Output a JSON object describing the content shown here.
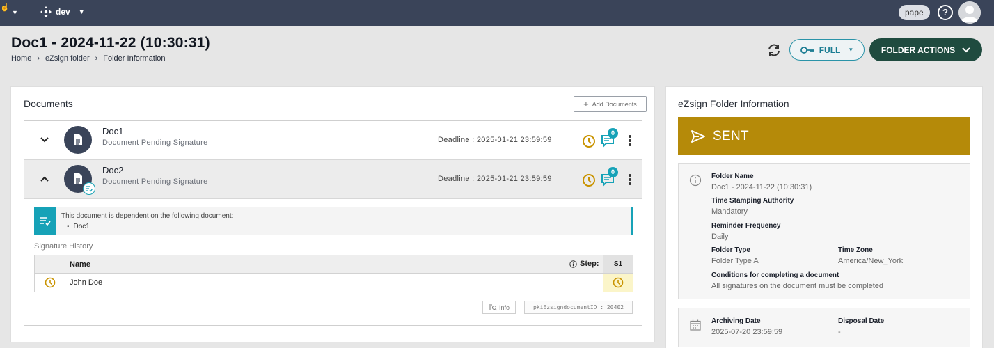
{
  "topbar": {
    "environment": "dev",
    "username": "pape",
    "help_symbol": "?"
  },
  "header": {
    "title": "Doc1 - 2024-11-22 (10:30:31)",
    "breadcrumb": [
      "Home",
      "eZsign folder",
      "Folder Information"
    ],
    "full_button_label": "FULL",
    "folder_actions_label": "FOLDER ACTIONS"
  },
  "documents": {
    "title": "Documents",
    "add_button_label": "Add Documents",
    "add_button_symbol": "+",
    "items": [
      {
        "name": "Doc1",
        "status": "Document Pending Signature",
        "deadline": "Deadline : 2025-01-21 23:59:59",
        "message_count": "0",
        "expanded": false
      },
      {
        "name": "Doc2",
        "status": "Document Pending Signature",
        "deadline": "Deadline : 2025-01-21 23:59:59",
        "message_count": "0",
        "expanded": true
      }
    ],
    "dependency": {
      "text": "This document is dependent on the following document:",
      "items": [
        "Doc1"
      ]
    },
    "signature_history": {
      "title": "Signature History",
      "header_name": "Name",
      "header_step": "Step:",
      "header_step_col": "S1",
      "rows": [
        {
          "name": "John Doe"
        }
      ]
    },
    "info_button_label": "Info",
    "document_id_label": "pkiEzsigndocumentID : 20402"
  },
  "folder_info": {
    "title": "eZsign Folder Information",
    "status": "SENT",
    "fields": {
      "folder_name_label": "Folder Name",
      "folder_name": "Doc1 - 2024-11-22 (10:30:31)",
      "tsa_label": "Time Stamping Authority",
      "tsa": "Mandatory",
      "reminder_label": "Reminder Frequency",
      "reminder": "Daily",
      "folder_type_label": "Folder Type",
      "folder_type": "Folder Type A",
      "time_zone_label": "Time Zone",
      "time_zone": "America/New_York",
      "conditions_label": "Conditions for completing a document",
      "conditions": "All signatures on the document must be completed"
    },
    "archiving": {
      "archiving_label": "Archiving Date",
      "archiving_date": "2025-07-20 23:59:59",
      "disposal_label": "Disposal Date",
      "disposal_date": "-"
    }
  },
  "colors": {
    "topbar": "#3a4459",
    "accent_teal": "#16a2b7",
    "folder_actions": "#1f4b3f",
    "sent_banner": "#b58a09",
    "pending_clock": "#c99300"
  }
}
